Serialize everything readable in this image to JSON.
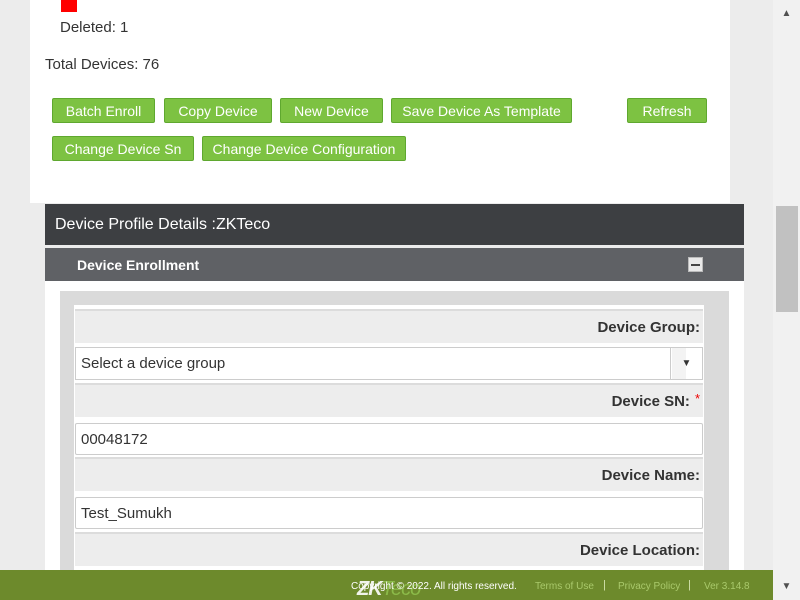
{
  "status": {
    "deleted": "Deleted: 1",
    "total_devices": "Total Devices: 76"
  },
  "buttons": {
    "batch_enroll": "Batch Enroll",
    "copy_device": "Copy Device",
    "new_device": "New Device",
    "save_template": "Save Device As Template",
    "refresh": "Refresh",
    "change_sn": "Change Device Sn",
    "change_config": "Change Device Configuration"
  },
  "panel": {
    "title": "Device Profile Details :ZKTeco",
    "section_title": "Device Enrollment"
  },
  "form": {
    "device_group_label": "Device Group:",
    "device_group_value": "Select a device group",
    "device_sn_label": "Device SN:",
    "required_mark": "*",
    "device_sn_value": "00048172",
    "device_name_label": "Device Name:",
    "device_name_value": "Test_Sumukh",
    "device_location_label": "Device Location:"
  },
  "footer": {
    "logo_main": "ZK",
    "logo_sub": "Teco",
    "copyright": "Copyright © 2022. All rights reserved.",
    "terms": "Terms of Use",
    "privacy": "Privacy Policy",
    "version": "Ver 3.14.8",
    "separator": "|"
  },
  "colors": {
    "button_green": "#7dc242",
    "header_dark": "#3d3f42",
    "footer_olive": "#6d8a2c",
    "required_red": "#ee0000"
  },
  "icons": {
    "collapse": "minus-icon",
    "dropdown": "caret-down-icon",
    "scroll_up": "scroll-up-arrow-icon",
    "scroll_down": "scroll-down-arrow-icon"
  }
}
